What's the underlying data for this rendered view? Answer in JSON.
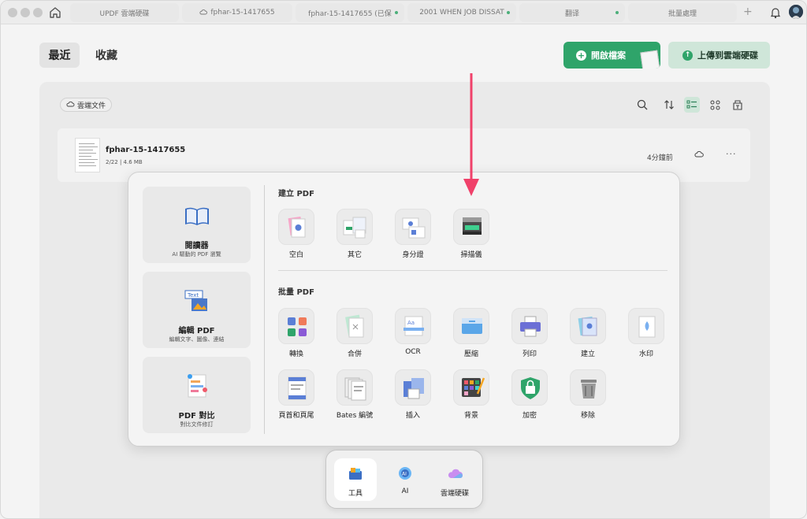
{
  "tabs": [
    {
      "label": "UPDF 雲端硬碟",
      "cloud": false,
      "dot": false
    },
    {
      "label": "fphar-15-1417655",
      "cloud": true,
      "dot": false
    },
    {
      "label": "fphar-15-1417655 (已保",
      "cloud": false,
      "dot": true
    },
    {
      "label": "2001 WHEN JOB DISSAT",
      "cloud": false,
      "dot": true
    },
    {
      "label": "翻译",
      "cloud": false,
      "dot": true
    },
    {
      "label": "批量處理",
      "cloud": false,
      "dot": false
    }
  ],
  "header": {
    "recent_label": "最近",
    "favorites_label": "收藏",
    "open_file_label": "開啟檔案",
    "upload_label": "上傳到雲端硬碟"
  },
  "content": {
    "cloud_chip_label": "雲端文件",
    "file": {
      "name": "fphar-15-1417655",
      "meta": "2/22  |  4.6 MB",
      "time": "4分鐘前",
      "more": "···"
    }
  },
  "tools_panel": {
    "side_cards": [
      {
        "title": "閱讀器",
        "subtitle": "AI 驅動的 PDF 瀏覽"
      },
      {
        "title": "編輯 PDF",
        "subtitle": "編輯文字、圖像、連結"
      },
      {
        "title": "PDF 對比",
        "subtitle": "對比文件修訂"
      }
    ],
    "create_title": "建立 PDF",
    "create_tools": [
      "空白",
      "其它",
      "身分證",
      "掃描儀"
    ],
    "batch_title": "批量 PDF",
    "batch_tools_row1": [
      "轉換",
      "合併",
      "OCR",
      "壓縮",
      "列印",
      "建立",
      "水印"
    ],
    "batch_tools_row2": [
      "頁首和頁尾",
      "Bates 編號",
      "插入",
      "背景",
      "加密",
      "移除"
    ]
  },
  "dock": {
    "items": [
      "工具",
      "AI",
      "雲端硬碟"
    ]
  },
  "colors": {
    "accent_green": "#2fa46a",
    "upload_bg": "#cfe6d9",
    "arrow_pink": "#f0416a"
  }
}
